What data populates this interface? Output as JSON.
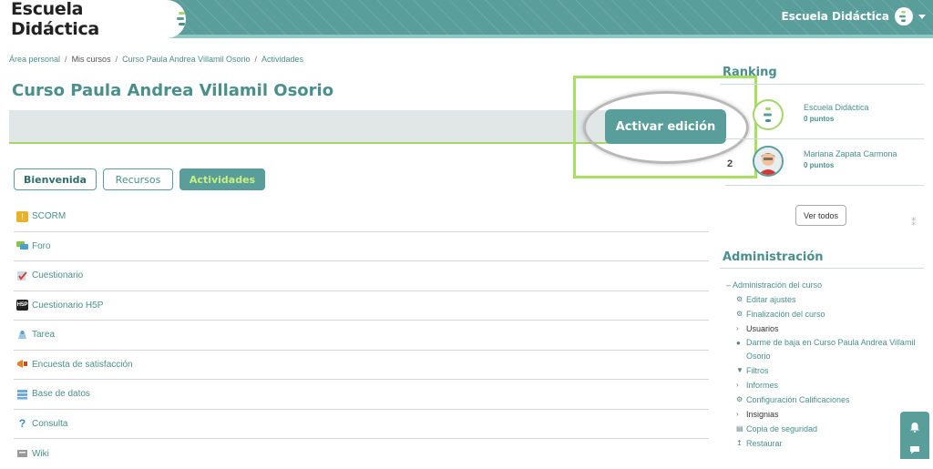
{
  "brand": {
    "name": "Escuela Didáctica",
    "logo_colors": [
      "#a5d56b",
      "#5a9e9b",
      "#4a8f8c"
    ]
  },
  "user_menu": {
    "name": "Escuela Didáctica"
  },
  "breadcrumb": [
    "Área personal",
    "Mis cursos",
    "Curso Paula Andrea Villamil Osorio",
    "Actividades"
  ],
  "page_title": "Curso Paula Andrea Villamil Osorio",
  "edit_button": "Activar edición",
  "tabs": [
    "Bienvenida",
    "Recursos",
    "Actividades"
  ],
  "active_tab": "Actividades",
  "activities": [
    {
      "label": "SCORM",
      "icon": "scorm-icon"
    },
    {
      "label": "Foro",
      "icon": "forum-icon"
    },
    {
      "label": "Cuestionario",
      "icon": "quiz-icon"
    },
    {
      "label": "Cuestionario H5P",
      "icon": "h5p-icon"
    },
    {
      "label": "Tarea",
      "icon": "assignment-icon"
    },
    {
      "label": "Encuesta de satisfacción",
      "icon": "survey-icon"
    },
    {
      "label": "Base de datos",
      "icon": "database-icon"
    },
    {
      "label": "Consulta",
      "icon": "question-icon"
    },
    {
      "label": "Wiki",
      "icon": "wiki-icon"
    }
  ],
  "ranking": {
    "title": "Ranking",
    "entries": [
      {
        "position": "",
        "name": "Escuela Didáctica",
        "points": "0 puntos"
      },
      {
        "position": "2",
        "name": "Mariana Zapata Carmona",
        "points": "0 puntos"
      }
    ],
    "see_all": "Ver todos"
  },
  "administration": {
    "title": "Administración",
    "root": "Administración del curso",
    "root_marker": "–",
    "items": [
      {
        "label": "Editar ajustes",
        "icon": "gear-icon",
        "marker": "⚙"
      },
      {
        "label": "Finalización del curso",
        "icon": "gear-icon",
        "marker": "⚙"
      },
      {
        "label": "Usuarios",
        "icon": "chevron-right-icon",
        "marker": "›"
      },
      {
        "label": "Darme de baja en Curso Paula Andrea Villamil Osorio",
        "icon": "user-icon",
        "marker": "●"
      },
      {
        "label": "Filtros",
        "icon": "filter-icon",
        "marker": "▼"
      },
      {
        "label": "Informes",
        "icon": "chevron-right-icon",
        "marker": "›"
      },
      {
        "label": "Configuración Calificaciones",
        "icon": "gear-icon",
        "marker": "⚙"
      },
      {
        "label": "Insignias",
        "icon": "chevron-right-icon",
        "marker": "›"
      },
      {
        "label": "Copia de seguridad",
        "icon": "file-icon",
        "marker": "▤"
      },
      {
        "label": "Restaurar",
        "icon": "upload-icon",
        "marker": "↥"
      }
    ]
  },
  "colors": {
    "primary": "#5a9e9b",
    "accent_green": "#a5d56b",
    "highlight_green": "#a5e060",
    "text_teal": "#4a8f8c"
  }
}
